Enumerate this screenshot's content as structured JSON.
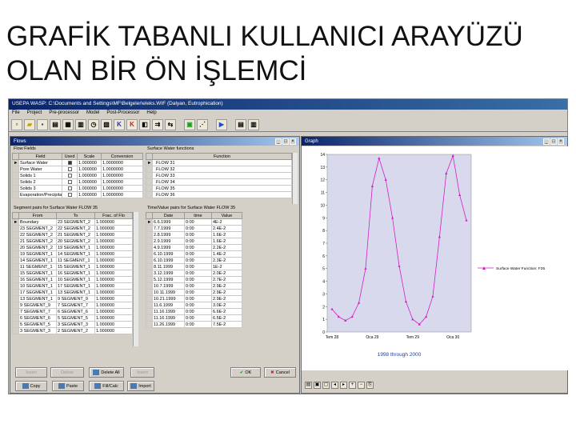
{
  "slide": {
    "title_line1": "GRAFİK TABANLI KULLANICI ARAYÜZÜ",
    "title_line2": "OLAN BİR ÖN İŞLEMCİ"
  },
  "app": {
    "title": "USEPA WASP: C:\\Documents and Settings\\MF\\Belgeler\\eleks.WIF (Dalyan, Eutrophication)",
    "menu": [
      "File",
      "Project",
      "Pre-processor",
      "Model",
      "Post-Processor",
      "Help"
    ]
  },
  "flows_window": {
    "title": "Flows",
    "flow_fields_label": "Flow Fields",
    "surface_functions_label": "Surface Water functions",
    "fields_headers": [
      "Field",
      "Used",
      "Scale",
      "Conversion"
    ],
    "fields_rows": [
      {
        "field": "Surface Water",
        "used": true,
        "scale": "1.000000",
        "conversion": "1.0000000"
      },
      {
        "field": "Pore Water",
        "used": false,
        "scale": "1.000000",
        "conversion": "1.0000000"
      },
      {
        "field": "Solids 1",
        "used": false,
        "scale": "1.000000",
        "conversion": "1.0000000"
      },
      {
        "field": "Solids 2",
        "used": false,
        "scale": "1.000000",
        "conversion": "1.0000000"
      },
      {
        "field": "Solids 3",
        "used": false,
        "scale": "1.000000",
        "conversion": "1.0000000"
      },
      {
        "field": "Evaporation/Precipitati",
        "used": false,
        "scale": "1.000000",
        "conversion": "1.0000000"
      }
    ],
    "function_header": "Function",
    "functions": [
      "FLOW 31",
      "FLOW 32",
      "FLOW 33",
      "FLOW 34",
      "FLOW 35",
      "FLOW 36"
    ],
    "segment_pairs_label": "Segment pairs for Surface Water FLOW 35",
    "timevalue_label": "Time/Value pairs for Surface Water FLOW 35",
    "seg_headers": [
      "From",
      "To",
      "Frac. of Flo"
    ],
    "seg_rows": [
      {
        "from": "Boundary",
        "to": "23 SEGMENT_2",
        "frac": "1.000000"
      },
      {
        "from": "23 SEGMENT_2",
        "to": "22 SEGMENT_2",
        "frac": "1.000000"
      },
      {
        "from": "22 SEGMENT_2",
        "to": "21 SEGMENT_2",
        "frac": "1.000000"
      },
      {
        "from": "21 SEGMENT_2",
        "to": "20 SEGMENT_2",
        "frac": "1.000000"
      },
      {
        "from": "20 SEGMENT_2",
        "to": "19 SEGMENT_1",
        "frac": "1.000000"
      },
      {
        "from": "19 SEGMENT_1",
        "to": "14 SEGMENT_1",
        "frac": "1.000000"
      },
      {
        "from": "14 SEGMENT_1",
        "to": "11 SEGMENT_1",
        "frac": "1.000000"
      },
      {
        "from": "11 SEGMENT_1",
        "to": "15 SEGMENT_1",
        "frac": "1.000000"
      },
      {
        "from": "15 SEGMENT_1",
        "to": "16 SEGMENT_1",
        "frac": "1.000000"
      },
      {
        "from": "16 SEGMENT_1",
        "to": "10 SEGMENT_1",
        "frac": "1.000000"
      },
      {
        "from": "10 SEGMENT_1",
        "to": "17 SEGMENT_1",
        "frac": "1.000000"
      },
      {
        "from": "17 SEGMENT_1",
        "to": "13 SEGMENT_1",
        "frac": "1.000000"
      },
      {
        "from": "13 SEGMENT_1",
        "to": "9 SEGMENT_9",
        "frac": "1.000000"
      },
      {
        "from": "9 SEGMENT_9",
        "to": "7 SEGMENT_7",
        "frac": "1.000000"
      },
      {
        "from": "7 SEGMENT_7",
        "to": "6 SEGMENT_6",
        "frac": "1.000000"
      },
      {
        "from": "6 SEGMENT_6",
        "to": "5 SEGMENT_5",
        "frac": "1.000000"
      },
      {
        "from": "5 SEGMENT_5",
        "to": "3 SEGMENT_3",
        "frac": "1.000000"
      },
      {
        "from": "3 SEGMENT_3",
        "to": "2 SEGMENT_2",
        "frac": "1.000000"
      }
    ],
    "tv_headers": [
      "Date",
      "time",
      "Value"
    ],
    "tv_rows": [
      {
        "date": "6.6.1999",
        "time": "0:00",
        "value": "4E-2"
      },
      {
        "date": "7.7.1999",
        "time": "0:00",
        "value": "2.4E-2"
      },
      {
        "date": "2.8.1999",
        "time": "0:00",
        "value": "1.6E-2"
      },
      {
        "date": "2.9.1999",
        "time": "0:00",
        "value": "1.6E-2"
      },
      {
        "date": "4.9.1999",
        "time": "0:00",
        "value": "2.2E-2"
      },
      {
        "date": "6.10.1999",
        "time": "0:00",
        "value": "1.4E-2"
      },
      {
        "date": "6.10.1999",
        "time": "0:00",
        "value": "2.3E-2"
      },
      {
        "date": "8.11.1999",
        "time": "0:00",
        "value": "1E-2"
      },
      {
        "date": "3.12.1999",
        "time": "0:00",
        "value": "2.0E-2"
      },
      {
        "date": "5.12.1999",
        "time": "0:00",
        "value": "2.7E-2"
      },
      {
        "date": "10.7.1999",
        "time": "0:00",
        "value": "2.9E-2"
      },
      {
        "date": "10.11.1999",
        "time": "0:00",
        "value": "2.9E-2"
      },
      {
        "date": "10.21.1999",
        "time": "0:00",
        "value": "2.9E-2"
      },
      {
        "date": "11.6.1999",
        "time": "0:00",
        "value": "3.0E-2"
      },
      {
        "date": "11.16.1999",
        "time": "0:00",
        "value": "6.6E-2"
      },
      {
        "date": "11.16.1999",
        "time": "0:00",
        "value": "6.5E-2"
      },
      {
        "date": "11.26.1999",
        "time": "0:00",
        "value": "7.5E-2"
      }
    ],
    "buttons": {
      "insert": "Insert",
      "delete": "Delete",
      "delete_all": "Delete All",
      "copy": "Copy",
      "paste": "Paste",
      "fillcalc": "Fill/Calc",
      "import": "Import",
      "ok": "OK",
      "cancel": "Cancel",
      "graph_insert": "Insert"
    }
  },
  "graph_window": {
    "title": "Graph",
    "footer_label": "1998 through 2000",
    "legend_label": "Surface Water Function: F35"
  },
  "chart_data": {
    "type": "line",
    "xlabel": "1998 through 2000",
    "x_tick_labels": [
      "Tem 28",
      "Oca 29",
      "Tem 29",
      "Oca 30"
    ],
    "y_tick_labels": [
      "0",
      "1",
      "2",
      "3",
      "4",
      "5",
      "6",
      "7",
      "8",
      "9",
      "10",
      "11",
      "12",
      "13",
      "14"
    ],
    "ylim": [
      0,
      14
    ],
    "x_range": [
      "Tem 28",
      "Oca 30"
    ],
    "series": [
      {
        "name": "Surface Water Function: F35",
        "color": "#d020c0",
        "x": [
          "Tem 28",
          "Ağu 28",
          "Eyl 28",
          "Eki 28",
          "Kas 28",
          "Ara 28",
          "Oca 29",
          "Şub 29",
          "Mar 29",
          "Nis 29",
          "May 29",
          "Haz 29",
          "Tem 29",
          "Ağu 29",
          "Eyl 29",
          "Eki 29",
          "Kas 29",
          "Ara 29",
          "Oca 30",
          "Şub 30",
          "Mar 30"
        ],
        "values": [
          1.8,
          1.2,
          0.9,
          1.2,
          2.3,
          5.0,
          11.5,
          13.7,
          12.0,
          9.0,
          5.2,
          2.4,
          1.0,
          0.6,
          1.2,
          2.8,
          7.5,
          12.5,
          13.9,
          10.8,
          8.8
        ]
      }
    ]
  }
}
